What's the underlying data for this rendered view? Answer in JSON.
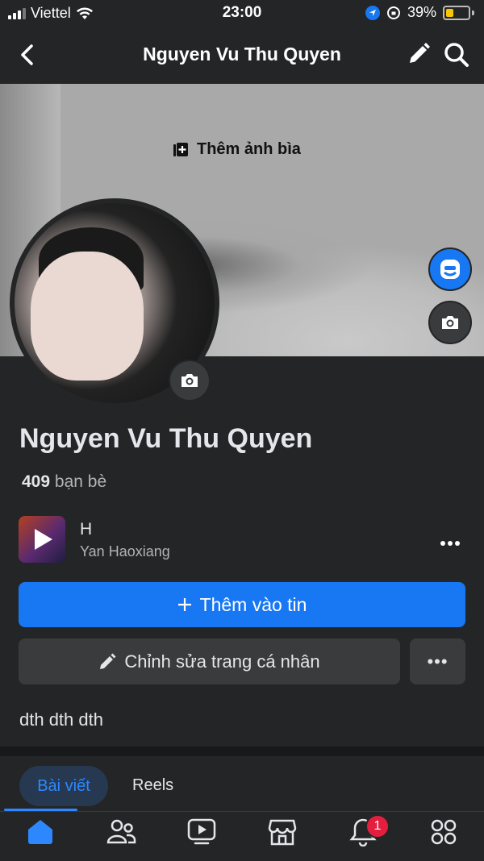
{
  "status_bar": {
    "carrier": "Viettel",
    "time": "23:00",
    "battery_percent": "39%"
  },
  "header": {
    "title": "Nguyen Vu Thu Quyen"
  },
  "cover": {
    "add_cover_label": "Thêm ảnh bìa"
  },
  "profile": {
    "name": "Nguyen Vu Thu Quyen",
    "friends_count": "409",
    "friends_label": "bạn bè",
    "bio": "dth dth dth"
  },
  "music": {
    "title": "H",
    "artist": "Yan Haoxiang"
  },
  "actions": {
    "add_story_label": "Thêm vào tin",
    "edit_profile_label": "Chỉnh sửa trang cá nhân",
    "more_label": "•••"
  },
  "tabs": [
    {
      "label": "Bài viết",
      "active": true
    },
    {
      "label": "Reels",
      "active": false
    }
  ],
  "bottom_nav": {
    "items": [
      "home-icon",
      "friends-icon",
      "video-icon",
      "marketplace-icon",
      "notifications-icon",
      "menu-icon"
    ],
    "notification_count": "1"
  },
  "colors": {
    "accent": "#1877f2",
    "background": "#242526",
    "badge": "#e41e3f"
  }
}
